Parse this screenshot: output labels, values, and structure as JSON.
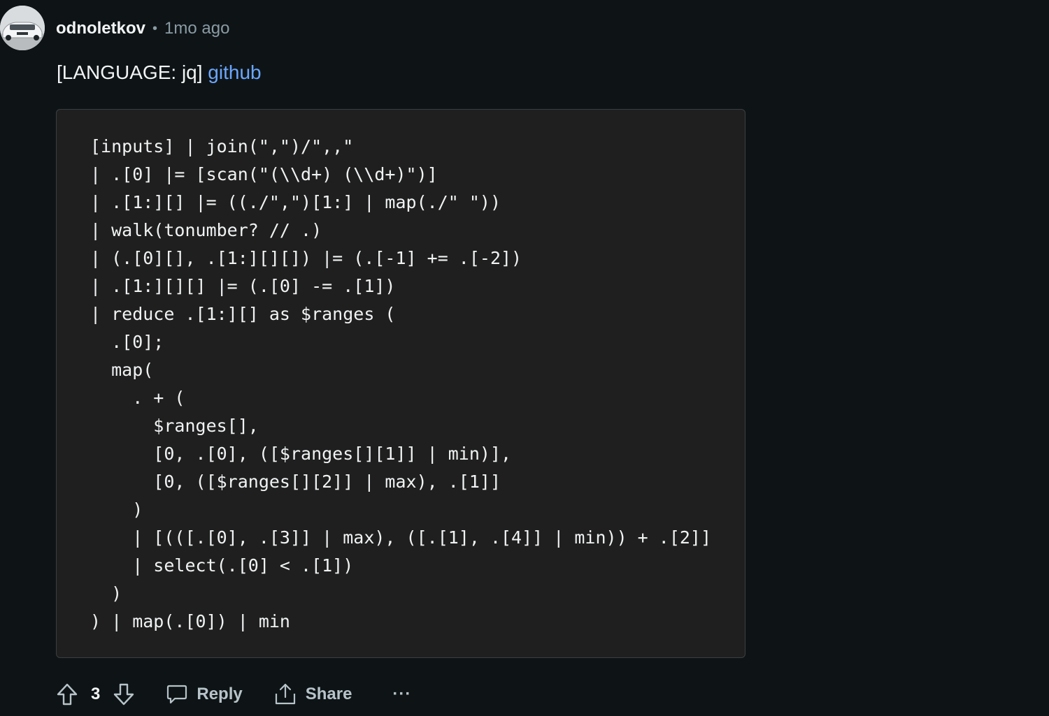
{
  "comment": {
    "author": "odnoletkov",
    "separator": "•",
    "time": "1mo ago",
    "body_prefix": "[LANGUAGE: jq] ",
    "link_text": "github",
    "code_lines": [
      "[inputs] | join(\",\")/\",,\"",
      "| .[0] |= [scan(\"(\\\\d+) (\\\\d+)\")]",
      "| .[1:][] |= ((./\",\")[1:] | map(./\" \"))",
      "| walk(tonumber? // .)",
      "| (.[0][], .[1:][][]) |= (.[-1] += .[-2])",
      "| .[1:][][] |= (.[0] -= .[1])",
      "| reduce .[1:][] as $ranges (",
      "  .[0];",
      "  map(",
      "    . + (",
      "      $ranges[],",
      "      [0, .[0], ([$ranges[][1]] | min)],",
      "      [0, ([$ranges[][2]] | max), .[1]]",
      "    )",
      "    | [(([.[0], .[3]] | max), ([.[1], .[4]] | min)) + .[2]]",
      "    | select(.[0] < .[1])",
      "  )",
      ") | map(.[0]) | min"
    ]
  },
  "actions": {
    "vote_count": "3",
    "reply_label": "Reply",
    "share_label": "Share",
    "more_label": "···"
  },
  "icons": {
    "upvote": "upvote-arrow-icon",
    "downvote": "downvote-arrow-icon",
    "reply": "speech-bubble-icon",
    "share": "share-upload-icon"
  },
  "colors": {
    "background": "#0e1416",
    "code_background": "#1f1f1f",
    "link": "#6ba6ff",
    "muted": "#8a9ba4"
  }
}
